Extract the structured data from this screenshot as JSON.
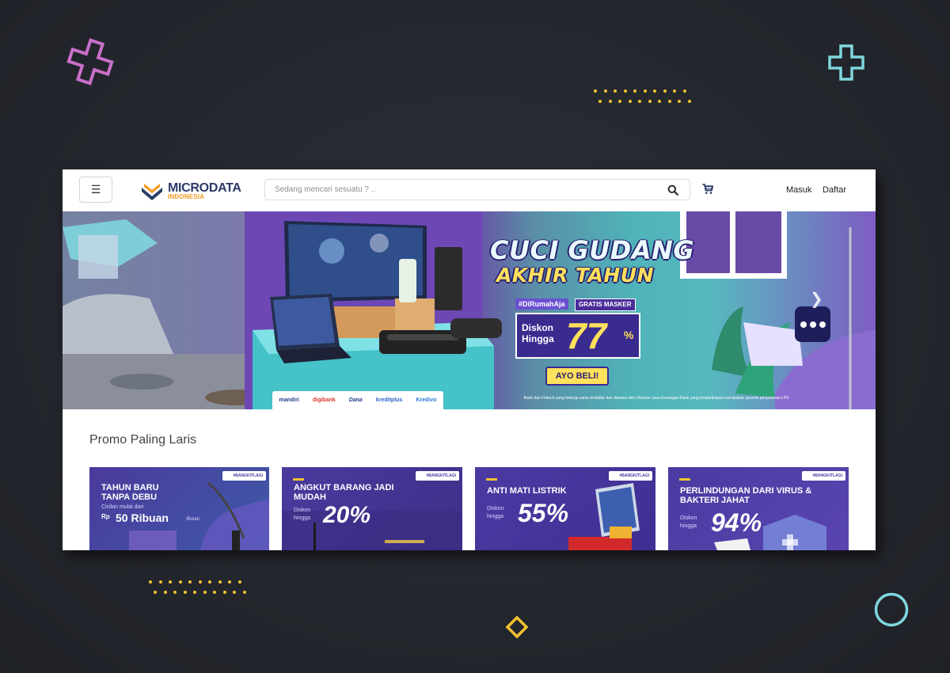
{
  "colors": {
    "background": "#272930",
    "accent_yellow": "#f1c232",
    "accent_pink": "#c86fc8",
    "accent_cyan": "#7fd6dd",
    "brand_navy": "#2b3a67",
    "brand_orange": "#f39a1e"
  },
  "header": {
    "menu_icon": "hamburger-icon",
    "logo": {
      "main": "MICRODATA",
      "sub": "INDONESIA"
    },
    "search": {
      "placeholder": "Sedang mencari sesuatu ? ..",
      "value": "",
      "icon": "search-icon"
    },
    "cart_icon": "cart-icon",
    "login_label": "Masuk",
    "register_label": "Daftar"
  },
  "banner": {
    "title_line1": "CUCI GUDANG",
    "title_line2": "AKHIR TAHUN",
    "hashtag": "#DiRumahAja",
    "gratis": "GRATIS MASKER",
    "discount_label": "Diskon Hingga",
    "discount_value": "77",
    "discount_unit": "%",
    "cta": "AYO BELI!",
    "banks": [
      "mandiri",
      "digibank",
      "Dana",
      "kreditplus",
      "Kredivo"
    ],
    "disclaimer": "Bank dan Fintech yang bekerja sama terdaftar dan diawasi oleh Otoritas Jasa Keuangan Bank yang berpartisipasi merupakan peserta penjaminan LPS",
    "next_icon": "chevron-right-icon"
  },
  "promo": {
    "title": "Promo Paling Laris",
    "cards": [
      {
        "tag": "#BANGKITLAGI",
        "title": "TAHUN BARU TANPA DEBU",
        "sub": "Cicilan mulai dari",
        "big_prefix": "Rp",
        "big": "50 Ribuan",
        "big_suffix": "/Bulan"
      },
      {
        "tag": "#BANGKITLAGI",
        "title": "ANGKUT BARANG JADI MUDAH",
        "sub": "Diskon hingga",
        "big": "20%"
      },
      {
        "tag": "#BANGKITLAGI",
        "title": "ANTI MATI LISTRIK",
        "sub": "Diskon hingga",
        "big": "55%"
      },
      {
        "tag": "#BANGKITLAGI",
        "title": "PERLINDUNGAN DARI VIRUS & BAKTERI JAHAT",
        "sub": "Diskon hingga",
        "big": "94%"
      }
    ]
  }
}
